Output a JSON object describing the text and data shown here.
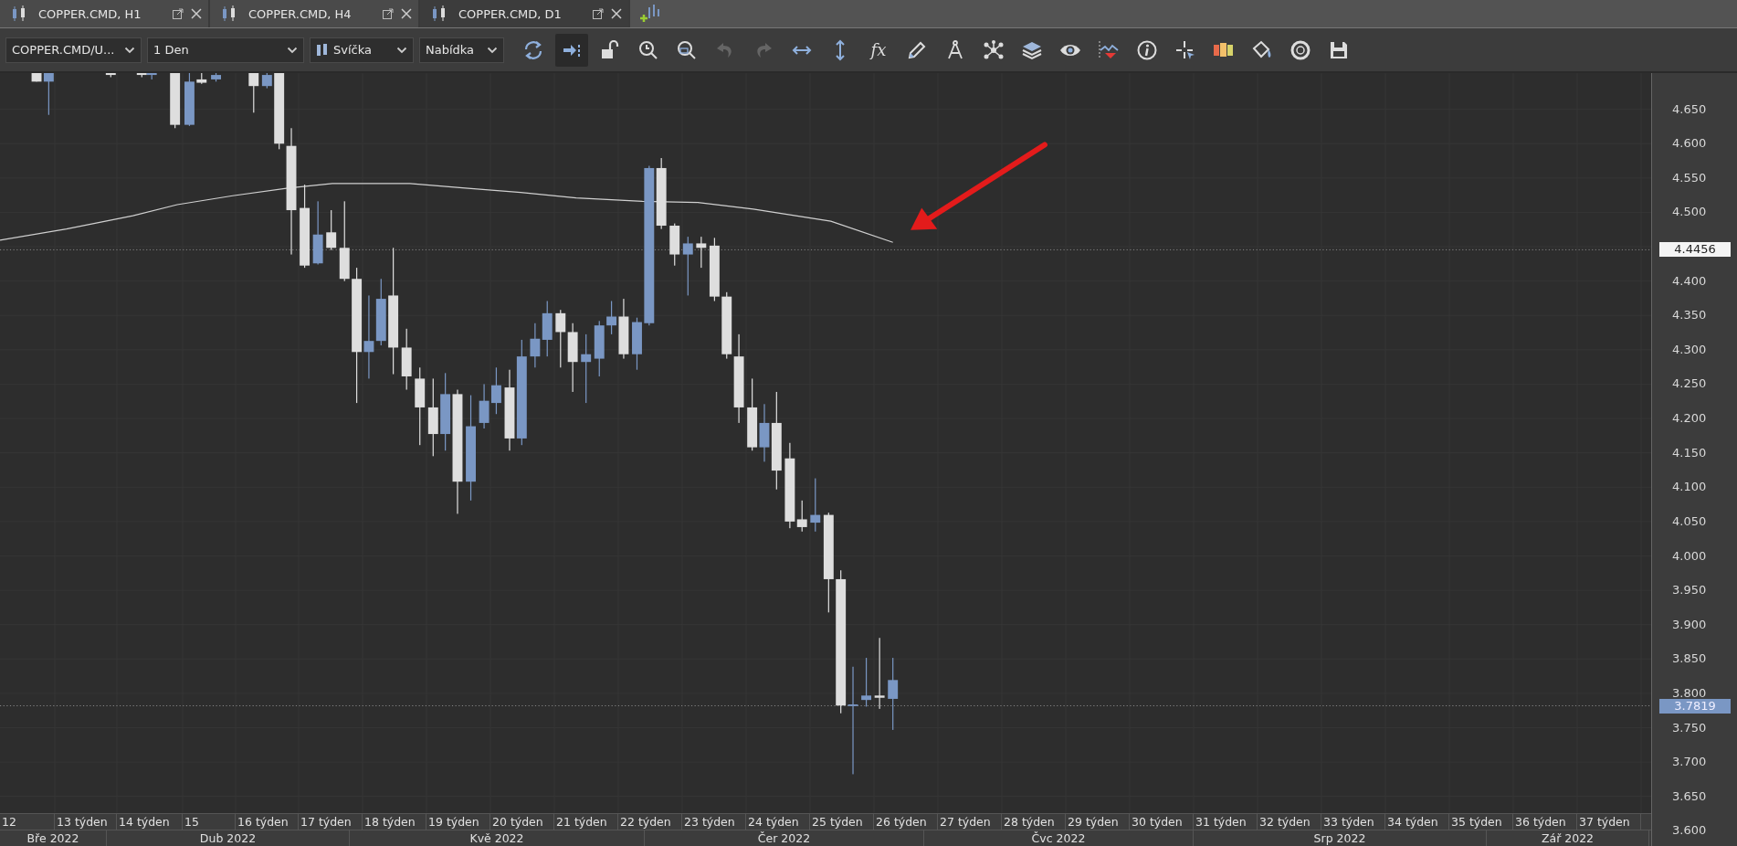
{
  "tabs": [
    {
      "label": "COPPER.CMD, H1",
      "selected": false
    },
    {
      "label": "COPPER.CMD, H4",
      "selected": false
    },
    {
      "label": "COPPER.CMD, D1",
      "selected": true
    }
  ],
  "toolbar": {
    "dropdowns": [
      {
        "value": "COPPER.CMD/U...",
        "kind": "plain"
      },
      {
        "value": "1 Den",
        "kind": "plain"
      },
      {
        "value": "Svíčka",
        "kind": "candle"
      },
      {
        "value": "Nabídka",
        "kind": "plain"
      }
    ],
    "tools": [
      {
        "kind": "refresh",
        "active": false,
        "disabled": false
      },
      {
        "kind": "shift",
        "active": true,
        "disabled": false
      },
      {
        "kind": "lock",
        "active": false,
        "disabled": false
      },
      {
        "kind": "clock-zoom",
        "active": false,
        "disabled": false
      },
      {
        "kind": "zoom-area",
        "active": false,
        "disabled": false
      },
      {
        "kind": "undo",
        "active": false,
        "disabled": true
      },
      {
        "kind": "redo",
        "active": false,
        "disabled": true
      },
      {
        "kind": "h-arrows",
        "active": false,
        "disabled": false
      },
      {
        "kind": "v-arrows",
        "active": false,
        "disabled": false
      },
      {
        "kind": "function",
        "label": "fx",
        "active": false,
        "disabled": false
      },
      {
        "kind": "pencil",
        "active": false,
        "disabled": false
      },
      {
        "kind": "compass",
        "active": false,
        "disabled": false
      },
      {
        "kind": "nodes",
        "active": false,
        "disabled": false
      },
      {
        "kind": "layers",
        "active": false,
        "disabled": false
      },
      {
        "kind": "eye",
        "active": false,
        "disabled": false
      },
      {
        "kind": "zigzag",
        "active": false,
        "disabled": false
      },
      {
        "kind": "info",
        "active": false,
        "disabled": false
      },
      {
        "kind": "crosshair",
        "active": false,
        "disabled": false
      },
      {
        "kind": "blocks",
        "active": false,
        "disabled": false
      },
      {
        "kind": "bucket",
        "active": false,
        "disabled": false
      },
      {
        "kind": "aperture",
        "active": false,
        "disabled": false
      },
      {
        "kind": "save",
        "active": false,
        "disabled": false
      }
    ]
  },
  "price_axis": {
    "labels": [
      "4.650",
      "4.600",
      "4.550",
      "4.500",
      "4.400",
      "4.350",
      "4.300",
      "4.250",
      "4.200",
      "4.150",
      "4.100",
      "4.050",
      "4.000",
      "3.950",
      "3.900",
      "3.850",
      "3.800",
      "3.750",
      "3.700",
      "3.650",
      "3.600"
    ],
    "markers": [
      {
        "value": "4.4456",
        "kind": "indicator"
      },
      {
        "value": "3.7819",
        "kind": "last"
      }
    ]
  },
  "time_axis": {
    "weeks": [
      "12",
      "13 týden",
      "14 týden",
      "15",
      "16 týden",
      "17 týden",
      "18 týden",
      "19 týden",
      "20 týden",
      "21 týden",
      "22 týden",
      "23 týden",
      "24 týden",
      "25 týden",
      "26 týden",
      "27 týden",
      "28 týden",
      "29 týden",
      "30 týden",
      "31 týden",
      "32 týden",
      "33 týden",
      "34 týden",
      "35 týden",
      "36 týden",
      "37 týden"
    ],
    "months": [
      "Bře 2022",
      "Dub 2022",
      "Kvě 2022",
      "Čer 2022",
      "Čvc 2022",
      "Srp 2022",
      "Zář 2022"
    ]
  }
}
